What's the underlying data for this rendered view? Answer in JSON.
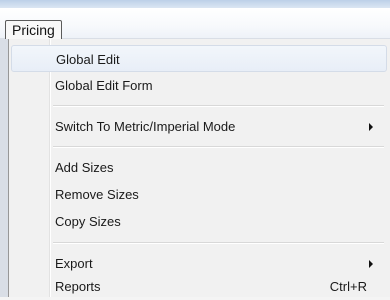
{
  "menubar": {
    "active_menu": "Pricing"
  },
  "menu": {
    "items": [
      {
        "label": "Global Edit",
        "shortcut": "",
        "submenu": false
      },
      {
        "label": "Global Edit Form",
        "shortcut": "",
        "submenu": false
      },
      {
        "label": "Switch To Metric/Imperial Mode",
        "shortcut": "",
        "submenu": true
      },
      {
        "label": "Add Sizes",
        "shortcut": "",
        "submenu": false
      },
      {
        "label": "Remove Sizes",
        "shortcut": "",
        "submenu": false
      },
      {
        "label": "Copy Sizes",
        "shortcut": "",
        "submenu": false
      },
      {
        "label": "Export",
        "shortcut": "",
        "submenu": true
      },
      {
        "label": "Reports",
        "shortcut": "Ctrl+R",
        "submenu": false
      }
    ],
    "submenu_arrow_icon": "chevron-right-icon"
  },
  "colors": {
    "menu_bg": "#f1f1f1",
    "hover_bg": "#e8eef7",
    "title_bar": "#bcd0e8"
  }
}
